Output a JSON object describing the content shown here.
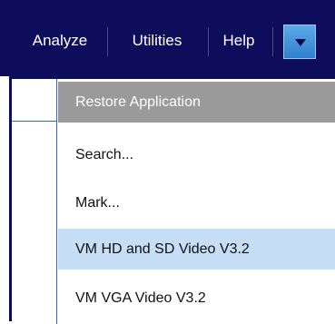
{
  "menubar": {
    "items": [
      {
        "label": "Analyze"
      },
      {
        "label": "Utilities"
      },
      {
        "label": "Help"
      }
    ],
    "dropdown_icon": "chevron-down-icon",
    "background_color": "#0d0d5c"
  },
  "dropdown_menu": {
    "items": [
      {
        "label": "Restore Application"
      },
      {
        "label": "Search..."
      },
      {
        "label": "Mark..."
      },
      {
        "label": "VM HD and SD Video V3.2"
      },
      {
        "label": "VM VGA Video V3.2"
      }
    ],
    "highlight_color": "#c6dff6",
    "disabled_row_color": "#9a9a9a"
  }
}
